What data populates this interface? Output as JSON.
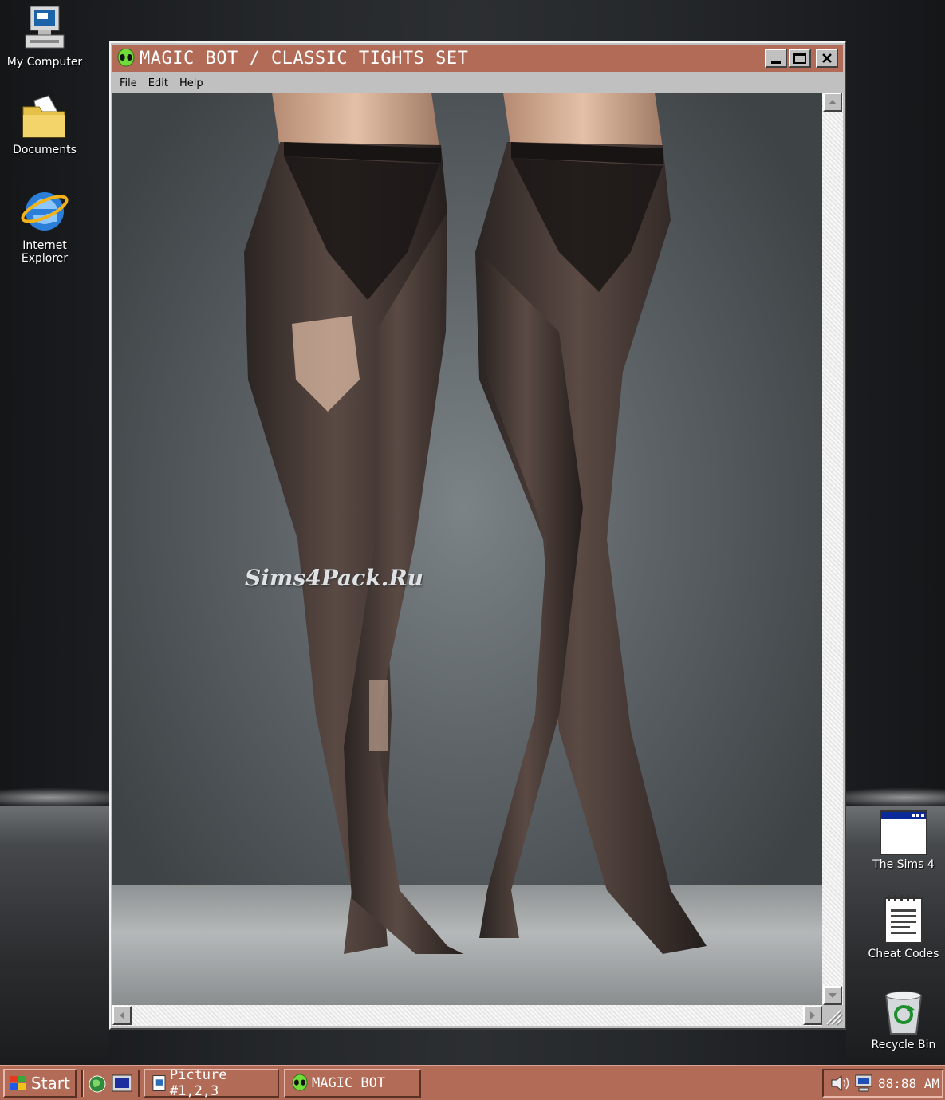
{
  "desktop": {
    "icons_left": [
      {
        "label": "My Computer",
        "icon": "computer-icon"
      },
      {
        "label": "Documents",
        "icon": "folder-icon"
      },
      {
        "label": "Internet Explorer",
        "icon": "internet-explorer-icon"
      }
    ],
    "icons_right": [
      {
        "label": "The Sims 4",
        "icon": "window-icon"
      },
      {
        "label": "Cheat Codes",
        "icon": "notepad-icon"
      },
      {
        "label": "Recycle Bin",
        "icon": "recycle-bin-icon"
      }
    ]
  },
  "window": {
    "title": "MAGIC BOT / CLASSIC TIGHTS SET",
    "menu": [
      "File",
      "Edit",
      "Help"
    ],
    "image_watermark": "Sims4Pack.Ru"
  },
  "taskbar": {
    "start_label": "Start",
    "tasks": [
      "Picture #1,2,3",
      "MAGIC BOT"
    ],
    "clock": "88:88 AM"
  },
  "colors": {
    "accent": "#b16b57",
    "chrome": "#c0c0c0"
  }
}
